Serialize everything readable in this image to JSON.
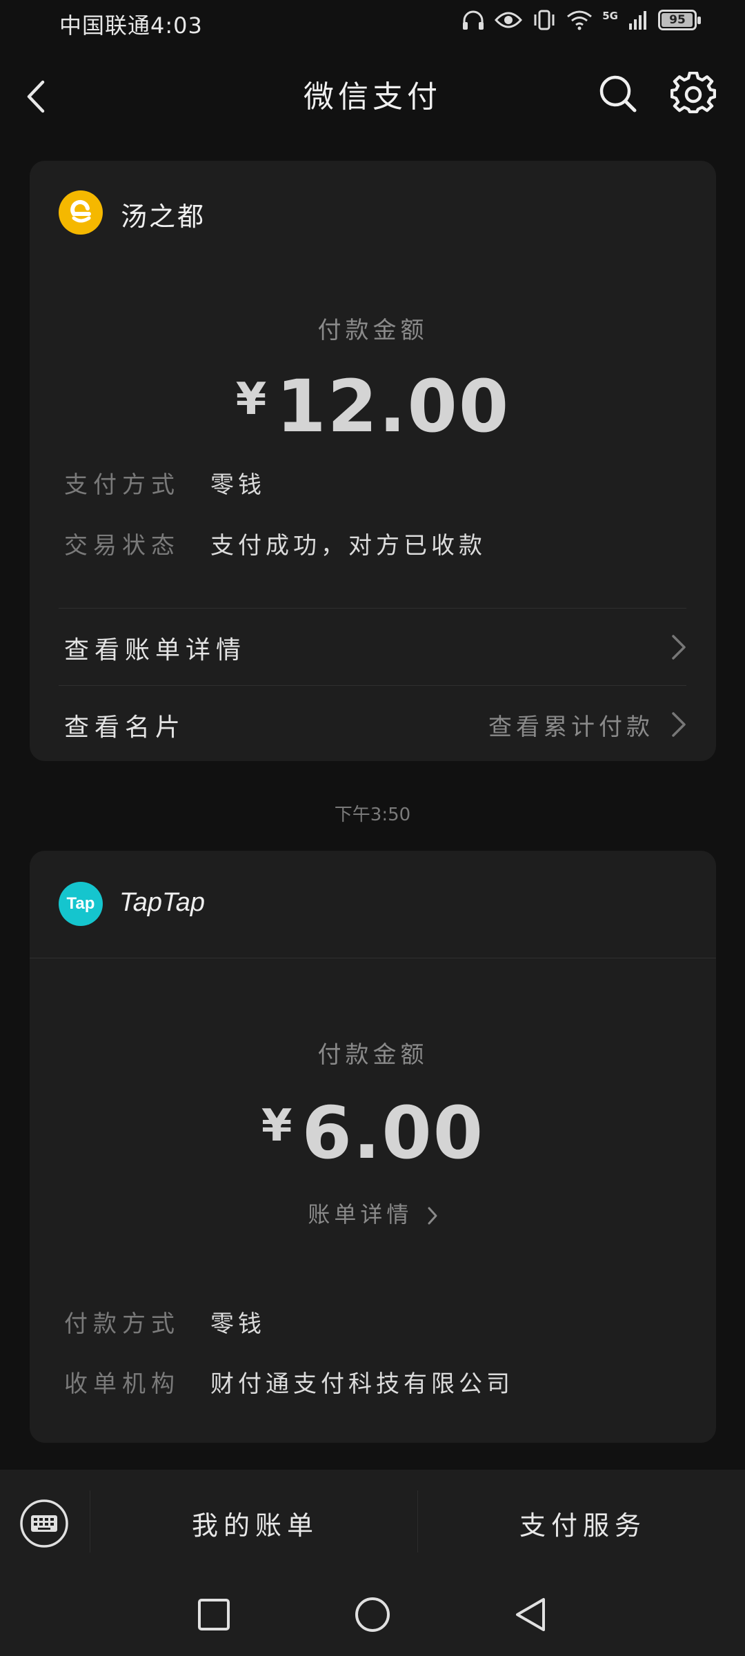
{
  "status": {
    "carrier_time": "中国联通4:03",
    "battery": "95",
    "network": "5G"
  },
  "header": {
    "title": "微信支付"
  },
  "card1": {
    "merchant": "汤之都",
    "amount_label": "付款金额",
    "currency": "¥",
    "amount": "12.00",
    "rows": [
      {
        "key": "支付方式",
        "value": "零钱"
      },
      {
        "key": "交易状态",
        "value": "支付成功，对方已收款"
      }
    ],
    "link1": "查看账单详情",
    "link2": "查看名片",
    "link2_sub": "查看累计付款"
  },
  "time_separator": "下午3:50",
  "card2": {
    "merchant": "TapTap",
    "logo_text": "Tap",
    "amount_label": "付款金额",
    "currency": "¥",
    "amount": "6.00",
    "bill_link": "账单详情",
    "rows": [
      {
        "key": "付款方式",
        "value": "零钱"
      },
      {
        "key": "收单机构",
        "value": "财付通支付科技有限公司"
      }
    ]
  },
  "bottom": {
    "my_bills": "我的账单",
    "pay_services": "支付服务"
  },
  "colors": {
    "background": "#111111",
    "card": "#1e1e1e",
    "merchant1_logo": "#f5b800",
    "merchant2_logo": "#15c5ce"
  },
  "icons": [
    "back-arrow-icon",
    "search-icon",
    "gear-icon",
    "chevron-right-icon",
    "keyboard-icon",
    "square-nav-icon",
    "circle-nav-icon",
    "triangle-back-nav-icon"
  ]
}
